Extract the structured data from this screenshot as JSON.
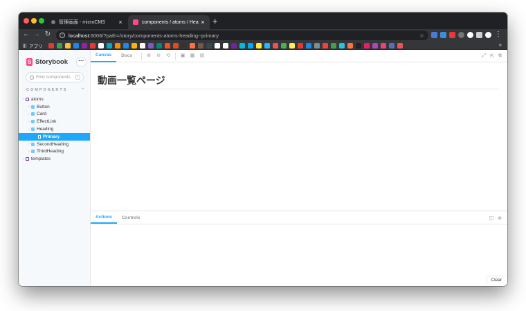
{
  "browser": {
    "tabs": [
      {
        "title": "管理画面 - microCMS",
        "icon": "microcms-icon"
      },
      {
        "title": "components / atoms / Heading",
        "icon": "storybook-icon"
      }
    ],
    "url_host": "localhost",
    "url_rest": ":6006/?path=/story/components-atoms-heading--primary",
    "bookmarks_apps_label": "アプリ",
    "bookmark_colors": [
      "#e53935",
      "#43a047",
      "#fbc02d",
      "#1e88e5",
      "#8e24aa",
      "#e53935",
      "#ffffff",
      "#00acc1",
      "#fb8c00",
      "#1e88e5",
      "#ffb300",
      "#ffffff",
      "#7e57c2",
      "#00897b",
      "#f4511e",
      "#e64a19",
      "#333333",
      "#ff7043",
      "#795548",
      "#37474f",
      "#ffffff",
      "#ffffff",
      "#7b1fa2",
      "#00bcd4",
      "#03a9f4",
      "#ffeb3b",
      "#29b6f6",
      "#ef5350",
      "#4caf50",
      "#ffee58",
      "#e53935",
      "#1e88e5",
      "#78909c",
      "#f44336",
      "#43a047",
      "#26c6da",
      "#ff7043",
      "#212121",
      "#e91e63",
      "#ab47bc",
      "#ec407a",
      "#5c6bc0",
      "#ef5350"
    ]
  },
  "storybook": {
    "name": "Storybook",
    "search_placeholder": "Find components",
    "search_shortcut": "/",
    "section_label": "COMPONENTS",
    "tree": [
      {
        "label": "atoms",
        "level": 0,
        "kind": "folder",
        "selected": false
      },
      {
        "label": "Button",
        "level": 1,
        "kind": "component",
        "selected": false
      },
      {
        "label": "Card",
        "level": 1,
        "kind": "component",
        "selected": false
      },
      {
        "label": "EffectLink",
        "level": 1,
        "kind": "component",
        "selected": false
      },
      {
        "label": "Heading",
        "level": 1,
        "kind": "component",
        "selected": false
      },
      {
        "label": "Primary",
        "level": 2,
        "kind": "story",
        "selected": true
      },
      {
        "label": "SecondHeading",
        "level": 1,
        "kind": "component",
        "selected": false
      },
      {
        "label": "ThirdHeading",
        "level": 1,
        "kind": "component",
        "selected": false
      },
      {
        "label": "templates",
        "level": 0,
        "kind": "folder",
        "selected": false
      }
    ],
    "main_tabs": [
      "Canvas",
      "Docs"
    ],
    "heading_text": "動画一覧ページ",
    "addon_tabs": [
      "Actions",
      "Controls"
    ],
    "clear_label": "Clear"
  }
}
